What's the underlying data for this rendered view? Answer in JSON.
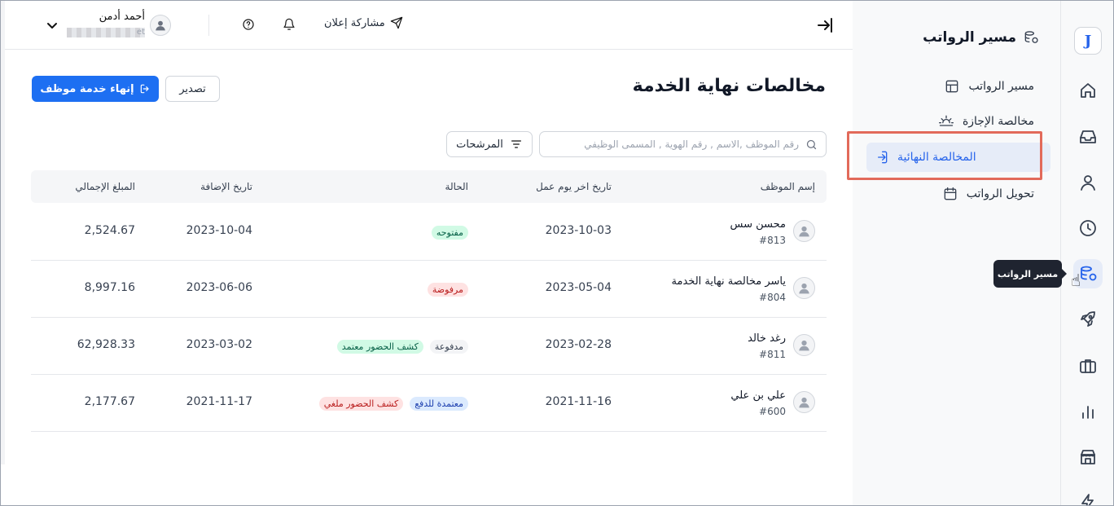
{
  "app": {
    "logo_letter": "J"
  },
  "topbar": {
    "share_label": "مشاركة إعلان",
    "user_name": "أحمد أدمن",
    "user_email_suffix": "et"
  },
  "subnav": {
    "title": "مسير الرواتب",
    "items": [
      {
        "label": "مسير الرواتب",
        "icon": "table-icon"
      },
      {
        "label": "مخالصة الإجازة",
        "icon": "sunset-icon"
      },
      {
        "label": "المخالصة النهائية",
        "icon": "logout-icon"
      },
      {
        "label": "تحويل الرواتب",
        "icon": "calendar-icon"
      }
    ]
  },
  "tooltip": {
    "text": "مسير الرواتب"
  },
  "page": {
    "title": "مخالصات نهاية الخدمة",
    "primary_button": "إنهاء خدمة موظف",
    "export_button": "تصدير",
    "search_placeholder": "رقم الموظف ,الاسم , رقم الهوية , المسمى الوظيفي",
    "filters_button": "المرشحات"
  },
  "table": {
    "headers": {
      "employee": "إسم الموظف",
      "last_day": "تاريخ اخر يوم عمل",
      "status": "الحالة",
      "added": "تاريخ الإضافة",
      "total": "المبلغ الإجمالي"
    },
    "rows": [
      {
        "name": "محسن سس",
        "id": "#813",
        "last_day": "2023-10-03",
        "badges": [
          {
            "text": "مفتوحه",
            "color": "green"
          }
        ],
        "added": "2023-10-04",
        "total": "2,524.67"
      },
      {
        "name": "ياسر مخالصة نهاية الخدمة",
        "id": "#804",
        "last_day": "2023-05-04",
        "badges": [
          {
            "text": "مرفوضة",
            "color": "red"
          }
        ],
        "added": "2023-06-06",
        "total": "8,997.16"
      },
      {
        "name": "رغد خالد",
        "id": "#811",
        "last_day": "2023-02-28",
        "badges": [
          {
            "text": "مدفوعة",
            "color": "gray"
          },
          {
            "text": "كشف الحضور معتمد",
            "color": "green"
          }
        ],
        "added": "2023-03-02",
        "total": "62,928.33"
      },
      {
        "name": "علي بن علي",
        "id": "#600",
        "last_day": "2021-11-16",
        "badges": [
          {
            "text": "معتمدة للدفع",
            "color": "blue"
          },
          {
            "text": "كشف الحضور ملغي",
            "color": "red"
          }
        ],
        "added": "2021-11-17",
        "total": "2,177.67"
      }
    ]
  },
  "colors": {
    "accent": "#1d6ff2",
    "active_bg": "#e6ecf8",
    "highlight_outline": "#e26a5a"
  }
}
